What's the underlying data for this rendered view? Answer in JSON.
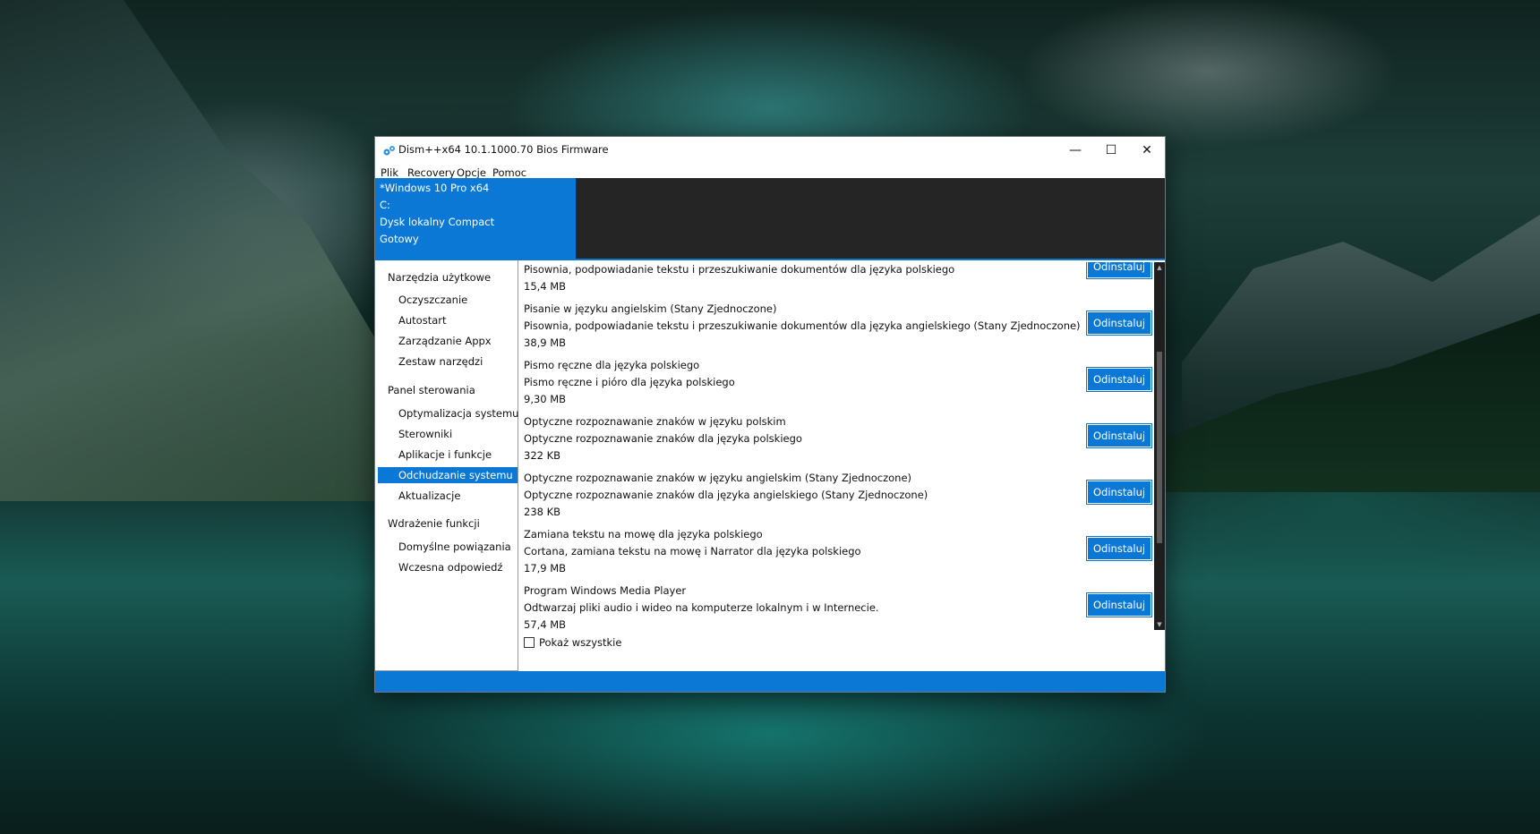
{
  "window": {
    "title": "Dism++x64 10.1.1000.70 Bios Firmware",
    "minimize": "—",
    "maximize": "☐",
    "close": "✕"
  },
  "menu": {
    "items": [
      "Plik",
      "Recovery",
      "Opcje",
      "Pomoc"
    ]
  },
  "info": {
    "os": "*Windows 10 Pro x64",
    "drive": "C:",
    "disk": "Dysk lokalny Compact",
    "status": "Gotowy"
  },
  "sidebar": {
    "groups": [
      {
        "heading": "Narzędzia użytkowe",
        "items": [
          "Oczyszczanie",
          "Autostart",
          "Zarządzanie Appx",
          "Zestaw narzędzi"
        ]
      },
      {
        "heading": "Panel sterowania",
        "items": [
          "Optymalizacja systemu",
          "Sterowniki",
          "Aplikacje i funkcje",
          "Odchudzanie systemu",
          "Aktualizacje"
        ]
      },
      {
        "heading": "Wdrażenie funkcji",
        "items": [
          "Domyślne powiązania",
          "Wczesna odpowiedź"
        ]
      }
    ],
    "selected": "Odchudzanie systemu"
  },
  "features": [
    {
      "name": "",
      "description": "Pisownia, podpowiadanie tekstu i przeszukiwanie dokumentów dla języka polskiego",
      "size": "15,4 MB",
      "button": "Odinstaluj"
    },
    {
      "name": "Pisanie w języku angielskim (Stany Zjednoczone)",
      "description": "Pisownia, podpowiadanie tekstu i przeszukiwanie dokumentów dla języka angielskiego (Stany Zjednoczone)",
      "size": "38,9 MB",
      "button": "Odinstaluj"
    },
    {
      "name": "Pismo ręczne dla języka polskiego",
      "description": "Pismo ręczne i pióro dla języka polskiego",
      "size": "9,30 MB",
      "button": "Odinstaluj"
    },
    {
      "name": "Optyczne rozpoznawanie znaków w języku polskim",
      "description": "Optyczne rozpoznawanie znaków dla języka polskiego",
      "size": "322 KB",
      "button": "Odinstaluj"
    },
    {
      "name": "Optyczne rozpoznawanie znaków w języku angielskim (Stany Zjednoczone)",
      "description": "Optyczne rozpoznawanie znaków dla języka angielskiego (Stany Zjednoczone)",
      "size": "238 KB",
      "button": "Odinstaluj"
    },
    {
      "name": "Zamiana tekstu na mowę dla języka polskiego",
      "description": "Cortana, zamiana tekstu na mowę i Narrator dla języka polskiego",
      "size": "17,9 MB",
      "button": "Odinstaluj"
    },
    {
      "name": "Program Windows Media Player",
      "description": "Odtwarzaj pliki audio i wideo na komputerze lokalnym i w Internecie.",
      "size": "57,4 MB",
      "button": "Odinstaluj"
    }
  ],
  "show_all": {
    "label": "Pokaż wszystkie",
    "checked": false
  },
  "colors": {
    "accent": "#0c78d6",
    "dark_panel": "#252526"
  }
}
